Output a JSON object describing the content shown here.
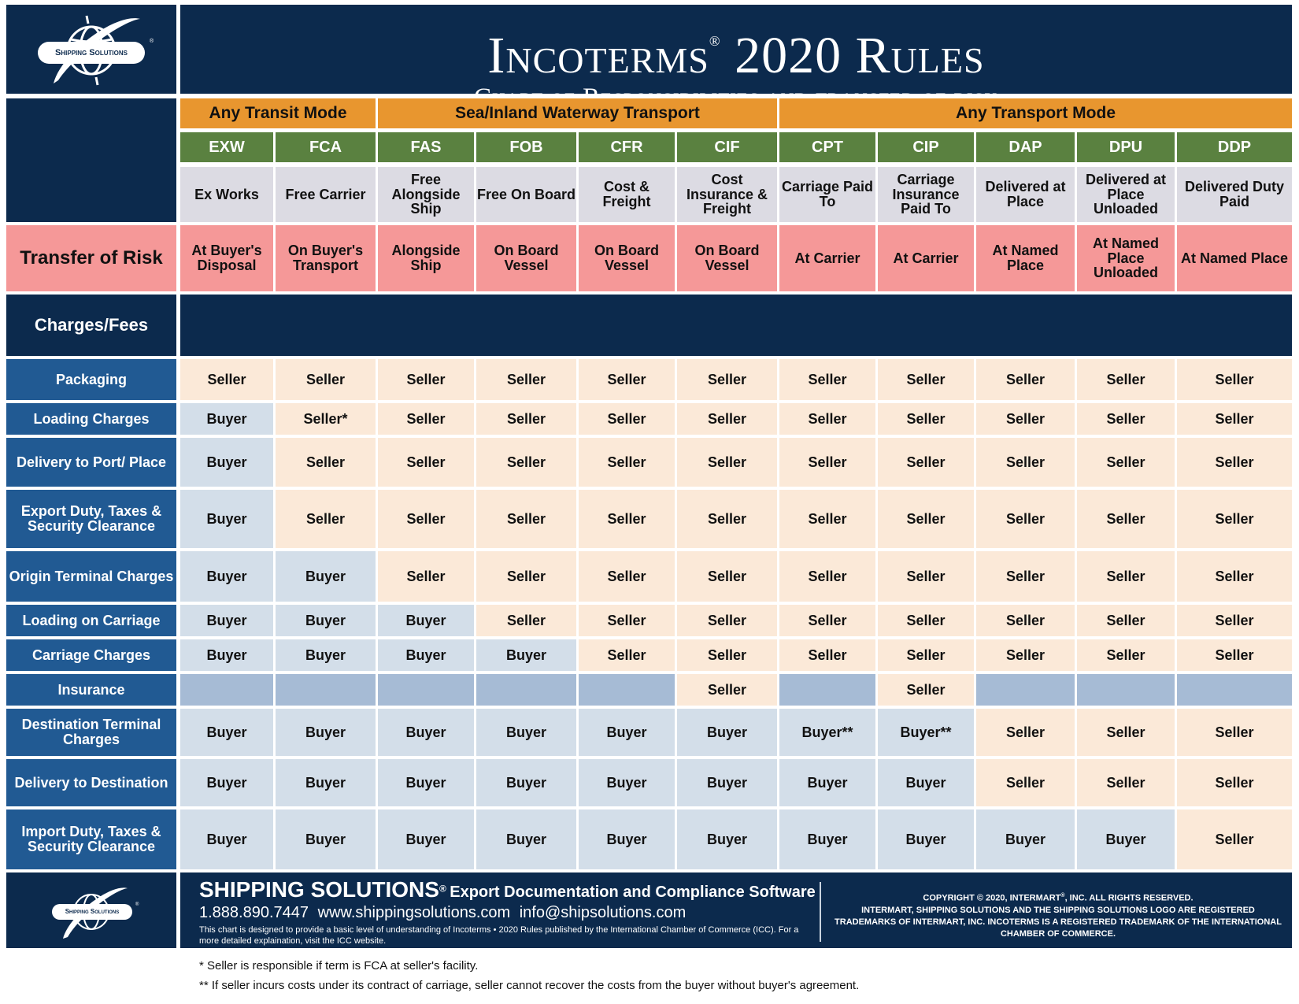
{
  "header": {
    "logo_text": "Shipping Solutions",
    "title": "Incoterms",
    "title_mark": "®",
    "title_rest": " 2020 Rules",
    "subtitle": "Chart of Responsibilities and transfer of risk"
  },
  "modes": [
    {
      "label": "Any Transit Mode",
      "span": 2
    },
    {
      "label": "Sea/Inland Waterway Transport",
      "span": 4
    },
    {
      "label": "Any Transport Mode",
      "span": 5
    }
  ],
  "terms": [
    {
      "code": "EXW",
      "name": "Ex Works",
      "risk": "At Buyer's Disposal"
    },
    {
      "code": "FCA",
      "name": "Free Carrier",
      "risk": "On Buyer's Transport"
    },
    {
      "code": "FAS",
      "name": "Free Alongside Ship",
      "risk": "Alongside Ship"
    },
    {
      "code": "FOB",
      "name": "Free On Board",
      "risk": "On Board Vessel"
    },
    {
      "code": "CFR",
      "name": "Cost & Freight",
      "risk": "On Board Vessel"
    },
    {
      "code": "CIF",
      "name": "Cost Insurance & Freight",
      "risk": "On Board Vessel"
    },
    {
      "code": "CPT",
      "name": "Carriage Paid To",
      "risk": "At Carrier"
    },
    {
      "code": "CIP",
      "name": "Carriage Insurance Paid To",
      "risk": "At Carrier"
    },
    {
      "code": "DAP",
      "name": "Delivered at Place",
      "risk": "At Named Place"
    },
    {
      "code": "DPU",
      "name": "Delivered at Place Unloaded",
      "risk": "At Named Place Unloaded"
    },
    {
      "code": "DDP",
      "name": "Delivered Duty Paid",
      "risk": "At Named Place"
    }
  ],
  "section_labels": {
    "risk": "Transfer of Risk",
    "charges": "Charges/Fees"
  },
  "charges": [
    {
      "label": "Packaging",
      "values": [
        "Seller",
        "Seller",
        "Seller",
        "Seller",
        "Seller",
        "Seller",
        "Seller",
        "Seller",
        "Seller",
        "Seller",
        "Seller"
      ]
    },
    {
      "label": "Loading Charges",
      "values": [
        "Buyer",
        "Seller*",
        "Seller",
        "Seller",
        "Seller",
        "Seller",
        "Seller",
        "Seller",
        "Seller",
        "Seller",
        "Seller"
      ]
    },
    {
      "label": "Delivery to Port/ Place",
      "values": [
        "Buyer",
        "Seller",
        "Seller",
        "Seller",
        "Seller",
        "Seller",
        "Seller",
        "Seller",
        "Seller",
        "Seller",
        "Seller"
      ]
    },
    {
      "label": "Export Duty, Taxes & Security Clearance",
      "values": [
        "Buyer",
        "Seller",
        "Seller",
        "Seller",
        "Seller",
        "Seller",
        "Seller",
        "Seller",
        "Seller",
        "Seller",
        "Seller"
      ]
    },
    {
      "label": "Origin Terminal Charges",
      "values": [
        "Buyer",
        "Buyer",
        "Seller",
        "Seller",
        "Seller",
        "Seller",
        "Seller",
        "Seller",
        "Seller",
        "Seller",
        "Seller"
      ]
    },
    {
      "label": "Loading on Carriage",
      "values": [
        "Buyer",
        "Buyer",
        "Buyer",
        "Seller",
        "Seller",
        "Seller",
        "Seller",
        "Seller",
        "Seller",
        "Seller",
        "Seller"
      ]
    },
    {
      "label": "Carriage Charges",
      "values": [
        "Buyer",
        "Buyer",
        "Buyer",
        "Buyer",
        "Seller",
        "Seller",
        "Seller",
        "Seller",
        "Seller",
        "Seller",
        "Seller"
      ]
    },
    {
      "label": "Insurance",
      "values": [
        "",
        "",
        "",
        "",
        "",
        "Seller",
        "",
        "Seller",
        "",
        "",
        ""
      ]
    },
    {
      "label": "Destination Terminal Charges",
      "values": [
        "Buyer",
        "Buyer",
        "Buyer",
        "Buyer",
        "Buyer",
        "Buyer",
        "Buyer**",
        "Buyer**",
        "Seller",
        "Seller",
        "Seller"
      ]
    },
    {
      "label": "Delivery to Destination",
      "values": [
        "Buyer",
        "Buyer",
        "Buyer",
        "Buyer",
        "Buyer",
        "Buyer",
        "Buyer",
        "Buyer",
        "Seller",
        "Seller",
        "Seller"
      ]
    },
    {
      "label": "Import Duty, Taxes & Security Clearance",
      "values": [
        "Buyer",
        "Buyer",
        "Buyer",
        "Buyer",
        "Buyer",
        "Buyer",
        "Buyer",
        "Buyer",
        "Buyer",
        "Buyer",
        "Seller"
      ]
    }
  ],
  "colors": {
    "navy": "#0c2a4d",
    "mode_orange": "#e8962f",
    "code_green": "#5a8140",
    "name_gray": "#dcdbe3",
    "risk_pink": "#f59898",
    "row_label_blue": "#215a93",
    "seller": "#fbe9d8",
    "buyer": "#d3dee9",
    "empty": "#a6bbd5"
  },
  "footer": {
    "logo_text": "Shipping Solutions",
    "brand": "SHIPPING SOLUTIONS",
    "brand_mark": "®",
    "tagline": "Export Documentation and Compliance Software",
    "phone": "1.888.890.7447",
    "website": "www.shippingsolutions.com",
    "email": "info@shipsolutions.com",
    "disclaimer": "This chart is designed to provide a basic level of understanding of Incoterms • 2020 Rules published by the International Chamber of Commerce (ICC). For a more detailed explaination, visit the ICC website.",
    "copyright_line1": "COPYRIGHT © 2020, INTERMART",
    "copyright_line1_rest": ", INC. ALL RIGHTS RESERVED.",
    "copyright_line2": "INTERMART, SHIPPING SOLUTIONS AND THE SHIPPING SOLUTIONS LOGO ARE REGISTERED TRADEMARKS OF INTERMART, INC. INCOTERMS IS A REGISTERED TRADEMARK OF THE INTERNATIONAL CHAMBER OF COMMERCE."
  },
  "footnotes": [
    "* Seller is responsible if term is FCA at seller's facility.",
    "** If seller incurs costs under its contract of carriage, seller cannot recover the costs from the buyer without buyer's agreement."
  ]
}
